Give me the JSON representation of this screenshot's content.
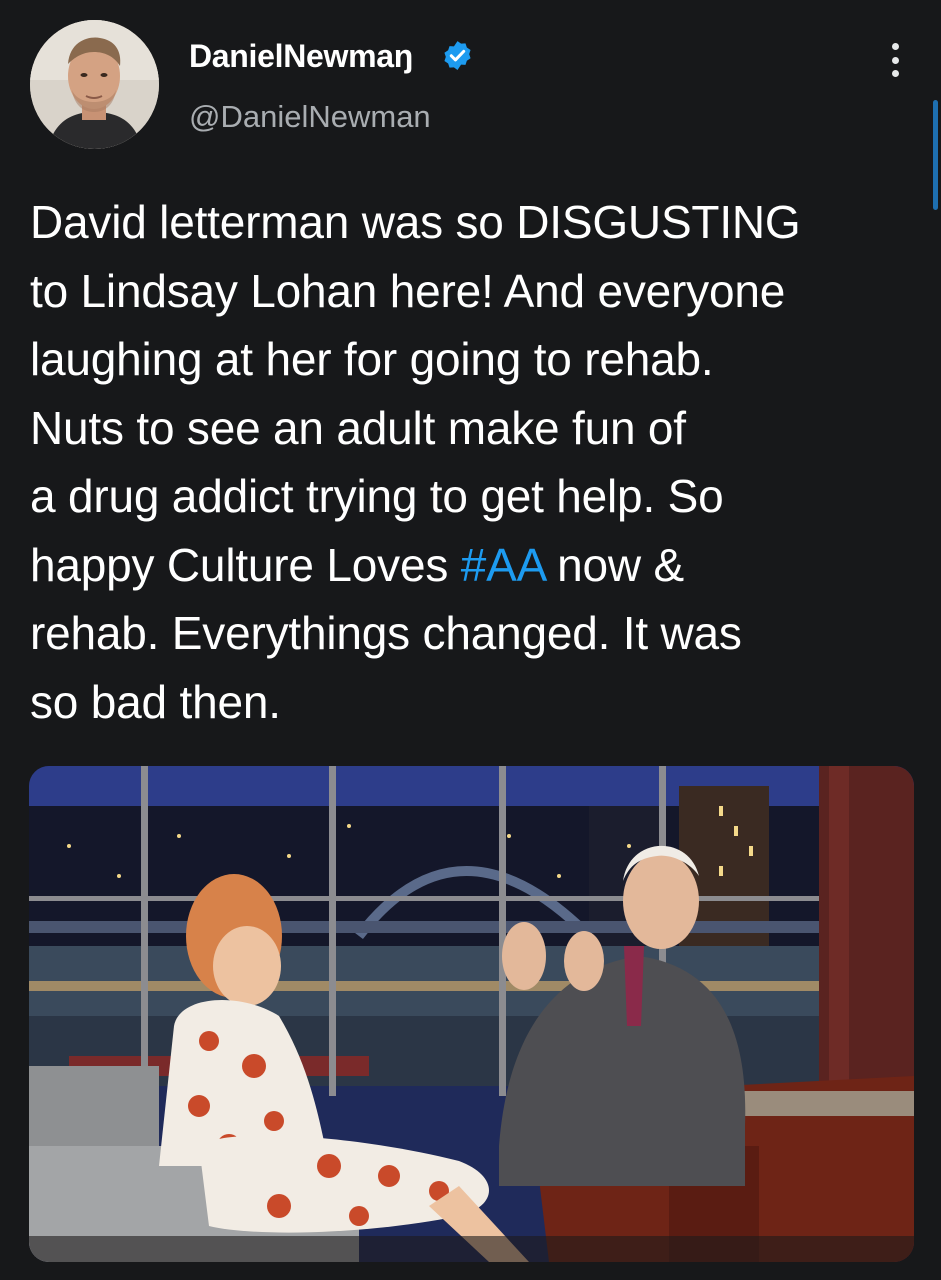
{
  "tweet": {
    "author": {
      "display_name": "DanielNewmaŋ",
      "handle": "@DanielNewman",
      "verified": true,
      "avatar_icon": "profile-photo-avatar"
    },
    "text_segments": [
      {
        "text": "David letterman was so DISGUSTING\nto Lindsay Lohan here! And everyone\nlaughing at her for going to rehab.\nNuts to see an adult make fun of\na drug addict trying to get help. So\nhappy Culture Loves ",
        "hashtag": false
      },
      {
        "text": "#AA",
        "hashtag": true
      },
      {
        "text": " now &\nrehab. Everythings changed. It was\nso bad then.",
        "hashtag": false
      }
    ],
    "media": {
      "type": "photo",
      "icon": "talk-show-photo"
    }
  },
  "icons": {
    "verified": "verified-badge-icon",
    "more": "more-options-icon"
  },
  "colors": {
    "background": "#17181a",
    "text": "#ffffff",
    "secondary_text": "#a9adb1",
    "hashtag": "#1d9bf0",
    "verified": "#1d9bf0"
  }
}
